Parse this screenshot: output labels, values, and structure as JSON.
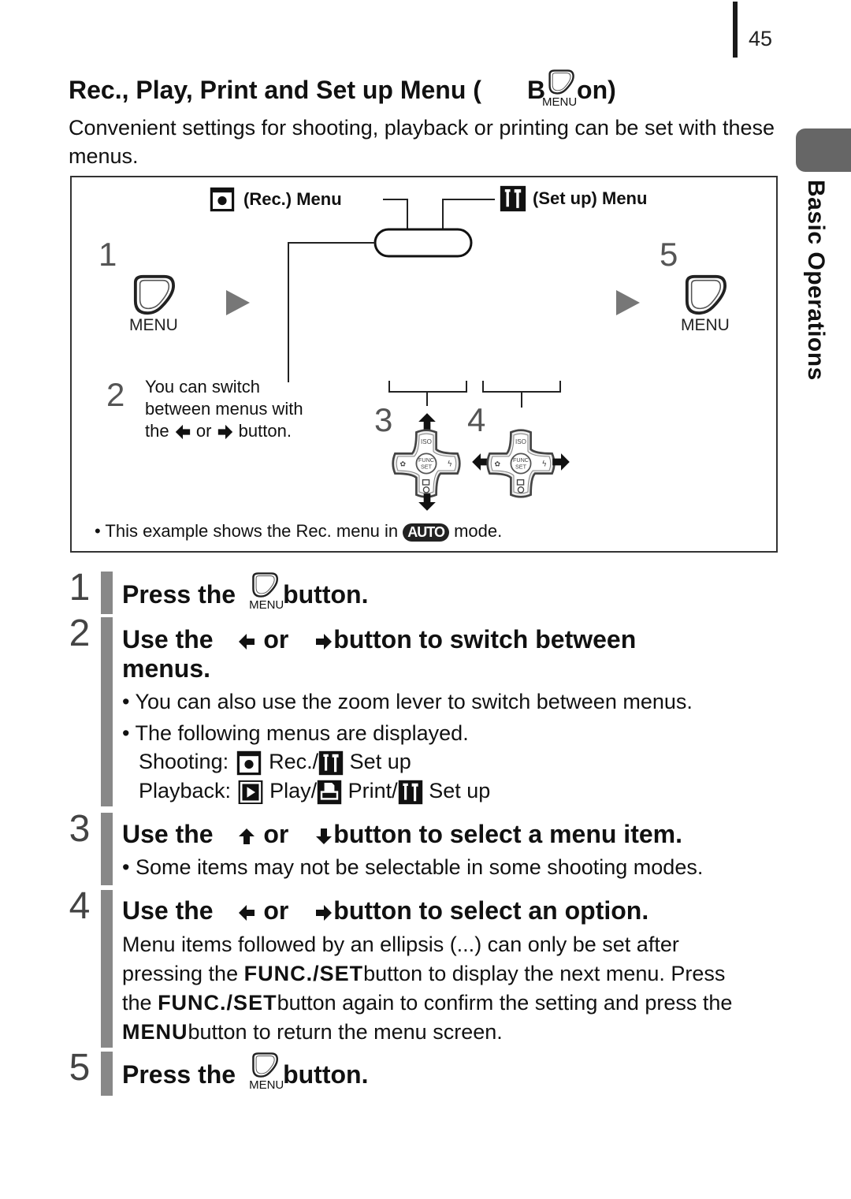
{
  "page": {
    "number": "45",
    "section_tab": "Basic Operations"
  },
  "heading": {
    "title_prefix": "Rec., Play, Print and Set up Menu (",
    "title_b": "B",
    "title_suffix": "on)",
    "menu_icon_caption": "MENU",
    "intro": "Convenient settings for shooting, playback or printing can be set with these menus."
  },
  "diagram": {
    "rec_menu_label": "(Rec.) Menu",
    "setup_menu_label": "(Set up) Menu",
    "step1_num": "1",
    "step5_num": "5",
    "menu_caption": "MENU",
    "step2_num": "2",
    "step2_line1": "You can switch",
    "step2_line2": "between menus with",
    "step2_the": "the",
    "step2_or": "or",
    "step2_button": "button.",
    "step3_num": "3",
    "step4_num": "4",
    "dpad_top": "ISO",
    "dpad_center_1": "FUNC",
    "dpad_center_2": "SET",
    "footnote_pre": "This example shows the Rec. menu in",
    "footnote_badge": "AUTO",
    "footnote_post": "mode."
  },
  "steps": [
    {
      "num": "1",
      "title_pre": "Press the",
      "icon_caption": "MENU",
      "title_post": "button."
    },
    {
      "num": "2",
      "title_pre": "Use the",
      "or": "or",
      "title_post": "button to switch between",
      "title_line2": "menus.",
      "bullets": [
        "You can also use the zoom lever to switch between menus.",
        "The following menus are displayed."
      ],
      "shooting_label": "Shooting:",
      "shooting_rec": "Rec./",
      "shooting_setup": "Set up",
      "playback_label": "Playback:",
      "playback_play": "Play/",
      "playback_print": "Print/",
      "playback_setup": "Set up"
    },
    {
      "num": "3",
      "title_pre": "Use the",
      "or": "or",
      "title_post": "button to select a menu item.",
      "bullets": [
        "Some items may not be selectable in some shooting modes."
      ]
    },
    {
      "num": "4",
      "title_pre": "Use the",
      "or": "or",
      "title_post": "button to select an option.",
      "body_1": "Menu items followed by an ellipsis (...) can only be set after",
      "body_2_pre": "pressing the",
      "func_set": "FUNC./SET",
      "body_2_post": "button to display the next menu. Press",
      "body_3_pre": "the",
      "body_3_post": "button again to confirm the setting and press the",
      "menu_kbd": "MENU",
      "body_4_post": "button to return the menu screen."
    },
    {
      "num": "5",
      "title_pre": "Press the",
      "icon_caption": "MENU",
      "title_post": "button."
    }
  ],
  "colors": {
    "step_bar": "#888888",
    "side_tab": "#666666",
    "arrow_gray": "#777777"
  }
}
